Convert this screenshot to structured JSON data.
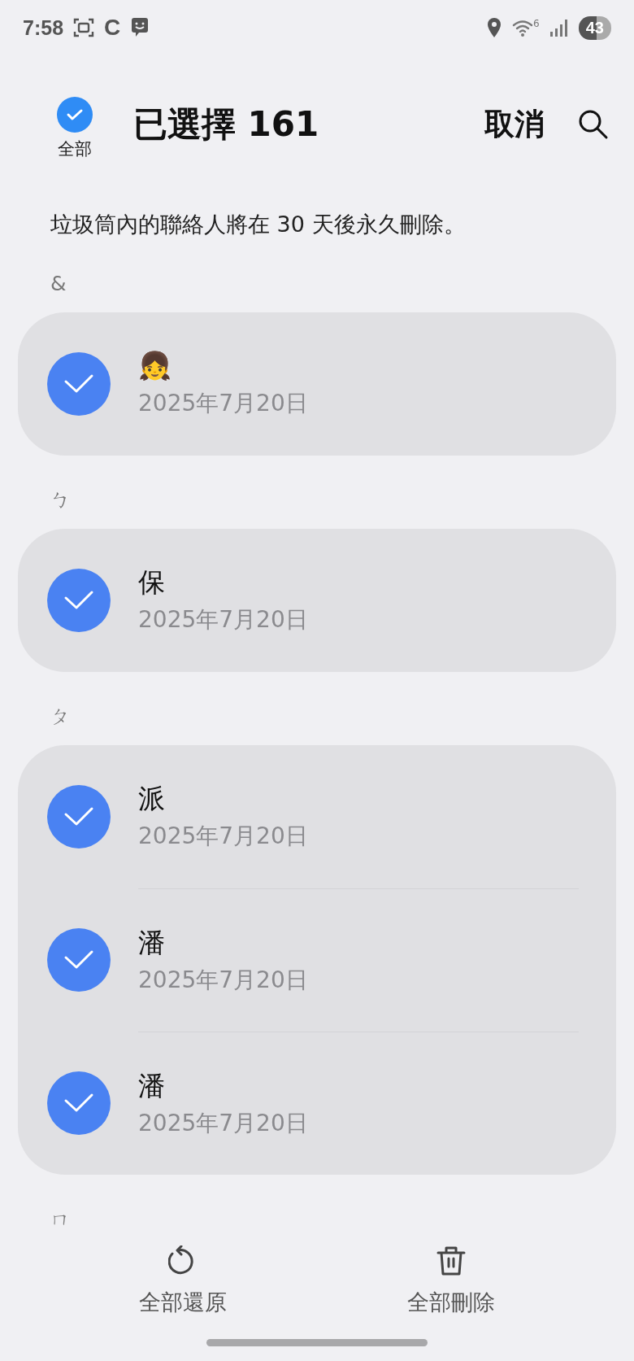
{
  "status_bar": {
    "time": "7:58",
    "app_letter": "C",
    "wifi_label": "6",
    "battery": "43"
  },
  "header": {
    "select_all": {
      "label": "全部",
      "checked": true
    },
    "title": "已選擇 161",
    "cancel": "取消"
  },
  "notice": "垃圾筒內的聯絡人將在 30 天後永久刪除。",
  "sections": [
    {
      "header": "&",
      "contacts": [
        {
          "name": "👧",
          "date": "2025年7月20日",
          "selected": true
        }
      ]
    },
    {
      "header": "ㄅ",
      "contacts": [
        {
          "name": "保",
          "date": "2025年7月20日",
          "selected": true
        }
      ]
    },
    {
      "header": "ㄆ",
      "contacts": [
        {
          "name": "派",
          "date": "2025年7月20日",
          "selected": true
        },
        {
          "name": "潘",
          "date": "2025年7月20日",
          "selected": true
        },
        {
          "name": "潘",
          "date": "2025年7月20日",
          "selected": true
        }
      ]
    },
    {
      "header": "ㄇ"
    }
  ],
  "bottom_bar": [
    {
      "kind": "restore",
      "label": "全部還原"
    },
    {
      "kind": "delete",
      "label": "全部刪除"
    }
  ]
}
